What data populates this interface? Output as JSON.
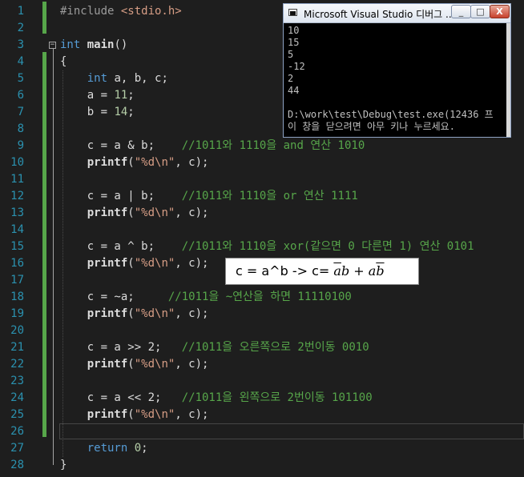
{
  "editor": {
    "line_numbers": [
      "1",
      "2",
      "3",
      "4",
      "5",
      "6",
      "7",
      "8",
      "9",
      "10",
      "11",
      "12",
      "13",
      "14",
      "15",
      "16",
      "17",
      "18",
      "19",
      "20",
      "21",
      "22",
      "23",
      "24",
      "25",
      "26",
      "27",
      "28"
    ],
    "lines": [
      {
        "line": 1,
        "tokens": [
          {
            "t": "#include ",
            "c": "pre"
          },
          {
            "t": "<stdio.h>",
            "c": "str"
          }
        ]
      },
      {
        "line": 2,
        "tokens": []
      },
      {
        "line": 3,
        "tokens": [
          {
            "t": "int",
            "c": "kw"
          },
          {
            "t": " "
          },
          {
            "t": "main",
            "c": "fn"
          },
          {
            "t": "()"
          }
        ]
      },
      {
        "line": 4,
        "tokens": [
          {
            "t": "{"
          }
        ]
      },
      {
        "line": 5,
        "tokens": [
          {
            "t": "    "
          },
          {
            "t": "int",
            "c": "kw"
          },
          {
            "t": " a, b, c;"
          }
        ]
      },
      {
        "line": 6,
        "tokens": [
          {
            "t": "    a = "
          },
          {
            "t": "11",
            "c": "num"
          },
          {
            "t": ";"
          }
        ]
      },
      {
        "line": 7,
        "tokens": [
          {
            "t": "    b = "
          },
          {
            "t": "14",
            "c": "num"
          },
          {
            "t": ";"
          }
        ]
      },
      {
        "line": 8,
        "tokens": []
      },
      {
        "line": 9,
        "tokens": [
          {
            "t": "    c = a & b;    "
          },
          {
            "t": "//1011와 1110을 and 연산 1010",
            "c": "com"
          }
        ]
      },
      {
        "line": 10,
        "tokens": [
          {
            "t": "    "
          },
          {
            "t": "printf",
            "c": "fn"
          },
          {
            "t": "("
          },
          {
            "t": "\"%d\\n\"",
            "c": "str"
          },
          {
            "t": ", c);"
          }
        ]
      },
      {
        "line": 11,
        "tokens": []
      },
      {
        "line": 12,
        "tokens": [
          {
            "t": "    c = a | b;    "
          },
          {
            "t": "//1011와 1110을 or 연산 1111",
            "c": "com"
          }
        ]
      },
      {
        "line": 13,
        "tokens": [
          {
            "t": "    "
          },
          {
            "t": "printf",
            "c": "fn"
          },
          {
            "t": "("
          },
          {
            "t": "\"%d\\n\"",
            "c": "str"
          },
          {
            "t": ", c);"
          }
        ]
      },
      {
        "line": 14,
        "tokens": []
      },
      {
        "line": 15,
        "tokens": [
          {
            "t": "    c = a ^ b;    "
          },
          {
            "t": "//1011와 1110을 xor(같으면 0 다른면 1) 연산 0101",
            "c": "com"
          }
        ]
      },
      {
        "line": 16,
        "tokens": [
          {
            "t": "    "
          },
          {
            "t": "printf",
            "c": "fn"
          },
          {
            "t": "("
          },
          {
            "t": "\"%d\\n\"",
            "c": "str"
          },
          {
            "t": ", c);"
          }
        ]
      },
      {
        "line": 17,
        "tokens": []
      },
      {
        "line": 18,
        "tokens": [
          {
            "t": "    c = ~a;     "
          },
          {
            "t": "//1011을 ~연산을 하면 11110100",
            "c": "com"
          }
        ]
      },
      {
        "line": 19,
        "tokens": [
          {
            "t": "    "
          },
          {
            "t": "printf",
            "c": "fn"
          },
          {
            "t": "("
          },
          {
            "t": "\"%d\\n\"",
            "c": "str"
          },
          {
            "t": ", c);"
          }
        ]
      },
      {
        "line": 20,
        "tokens": []
      },
      {
        "line": 21,
        "tokens": [
          {
            "t": "    c = a >> 2;   "
          },
          {
            "t": "//1011을 오른쪽으로 2번이동 0010",
            "c": "com"
          }
        ]
      },
      {
        "line": 22,
        "tokens": [
          {
            "t": "    "
          },
          {
            "t": "printf",
            "c": "fn"
          },
          {
            "t": "("
          },
          {
            "t": "\"%d\\n\"",
            "c": "str"
          },
          {
            "t": ", c);"
          }
        ]
      },
      {
        "line": 23,
        "tokens": []
      },
      {
        "line": 24,
        "tokens": [
          {
            "t": "    c = a << 2;   "
          },
          {
            "t": "//1011을 왼쪽으로 2번이동 101100",
            "c": "com"
          }
        ]
      },
      {
        "line": 25,
        "tokens": [
          {
            "t": "    "
          },
          {
            "t": "printf",
            "c": "fn"
          },
          {
            "t": "("
          },
          {
            "t": "\"%d\\n\"",
            "c": "str"
          },
          {
            "t": ", c);"
          }
        ]
      },
      {
        "line": 26,
        "tokens": []
      },
      {
        "line": 27,
        "tokens": [
          {
            "t": "    "
          },
          {
            "t": "return",
            "c": "kw"
          },
          {
            "t": " "
          },
          {
            "t": "0",
            "c": "num"
          },
          {
            "t": ";"
          }
        ]
      },
      {
        "line": 28,
        "tokens": [
          {
            "t": "}"
          }
        ]
      }
    ]
  },
  "console": {
    "title": "Microsoft Visual Studio 디버그 ...",
    "min_label": "_",
    "max_label": "□",
    "close_label": "X",
    "output": "10\n15\n5\n-12\n2\n44\n\nD:\\work\\test\\Debug\\test.exe(12436 프\n이 창을 닫으려면 아무 키나 누르세요."
  },
  "annotation": {
    "prefix": "c = a^b  ->  c=",
    "term1_a": "a",
    "term1_b": "b",
    "plus": " + ",
    "term2_a": "a",
    "term2_b": "b"
  },
  "colors": {
    "background": "#1e1e1e",
    "line_number": "#2b91af",
    "keyword": "#569cd6",
    "string": "#d69d85",
    "comment": "#57a64a",
    "number": "#b5cea8",
    "change_bar": "#57a64a"
  }
}
